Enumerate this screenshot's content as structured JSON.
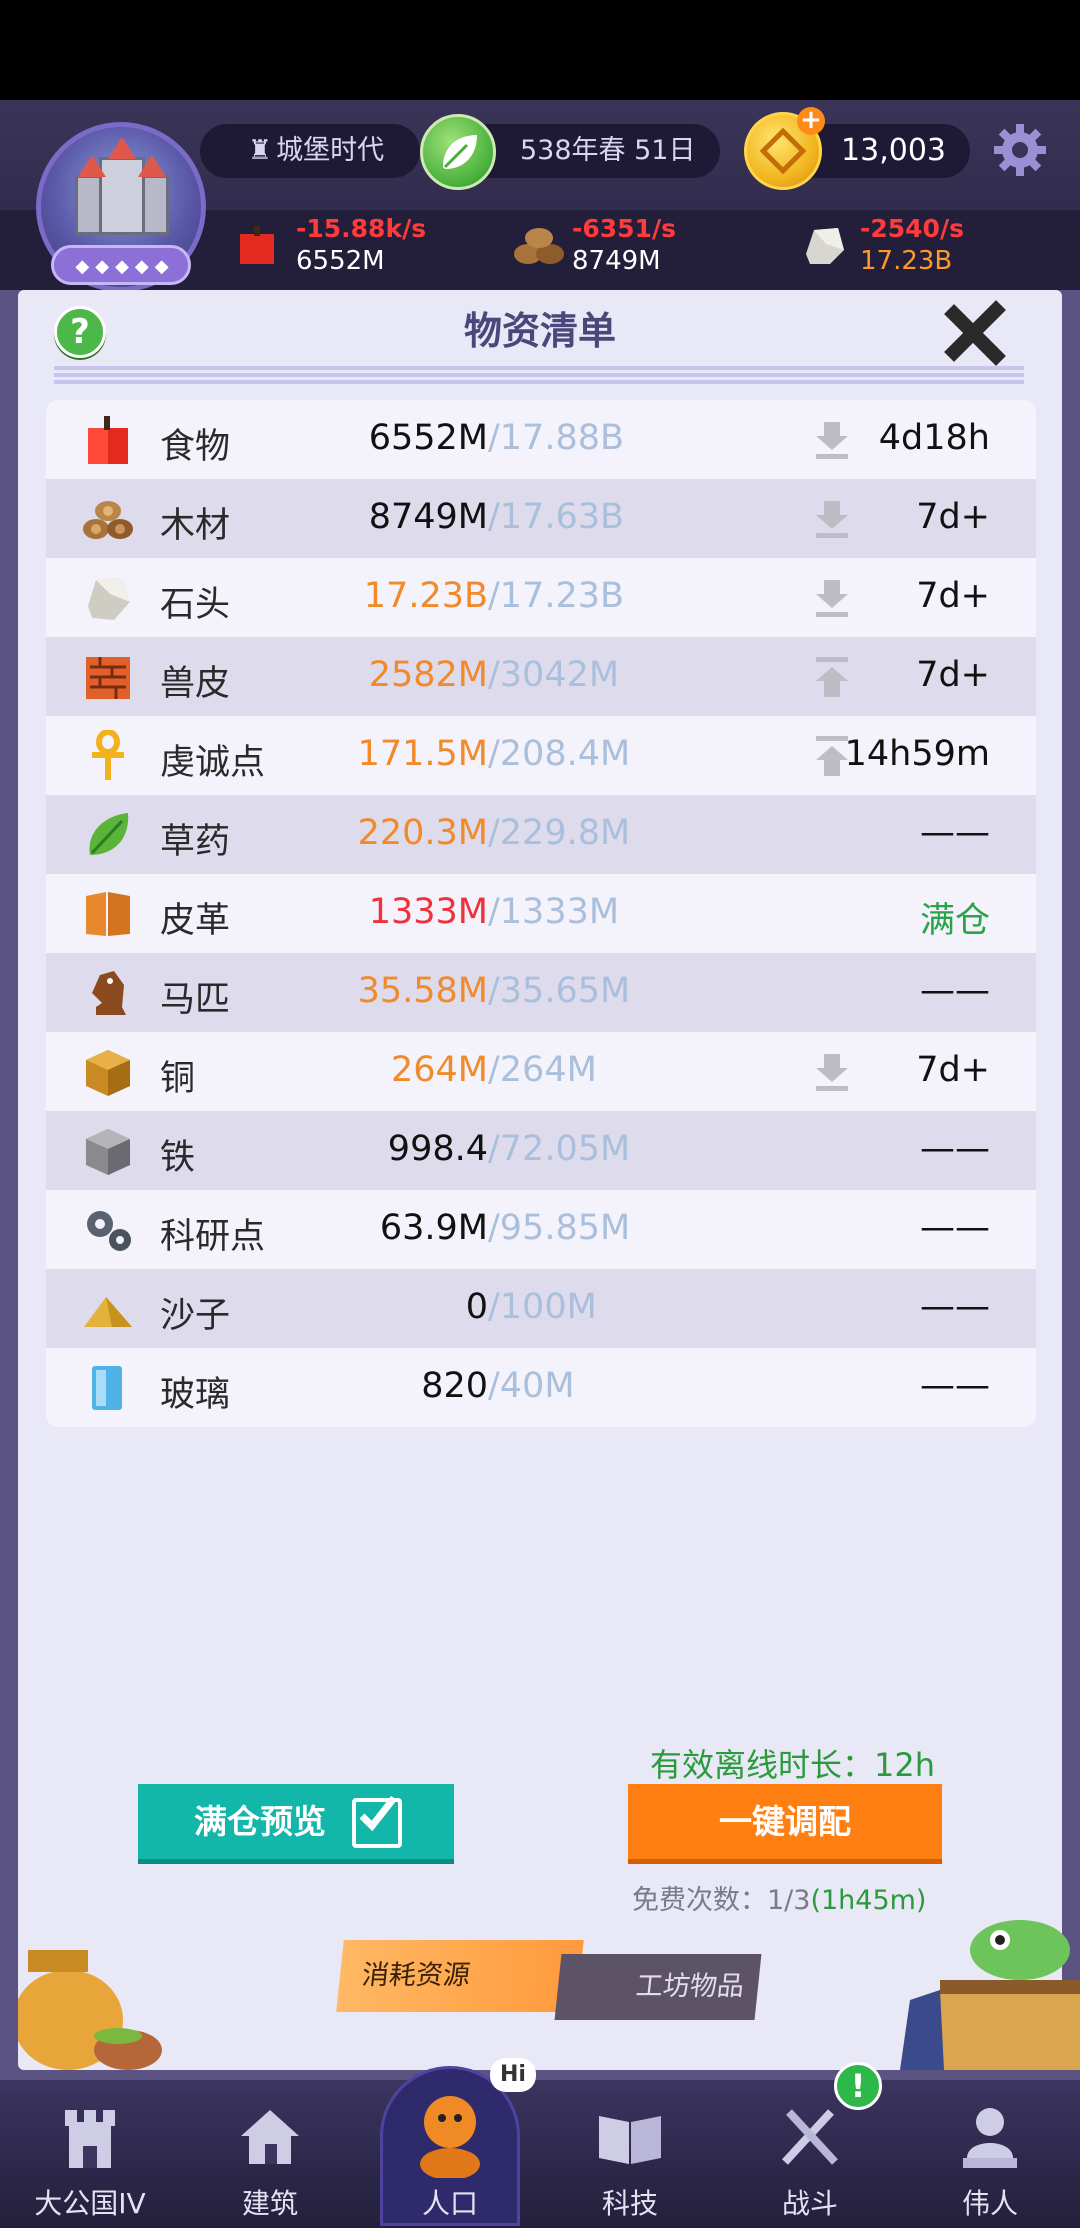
{
  "header": {
    "era": "城堡时代",
    "date": "538年春 51日",
    "gold": "13,003",
    "resources_top": [
      {
        "name": "food",
        "rate": "-15.88k/s",
        "amount": "6552M",
        "amount_color": "#ffffff"
      },
      {
        "name": "wood",
        "rate": "-6351/s",
        "amount": "8749M",
        "amount_color": "#ffffff"
      },
      {
        "name": "stone",
        "rate": "-2540/s",
        "amount": "17.23B",
        "amount_color": "#ff9a2a"
      }
    ]
  },
  "panel": {
    "title": "物资清单",
    "help": "?",
    "items": [
      {
        "icon": "apple-icon",
        "name": "食物",
        "amount": "6552M",
        "amount_color": "black",
        "cap": "/17.88B",
        "trend": "down",
        "time": "4d18h"
      },
      {
        "icon": "wood-logs-icon",
        "name": "木材",
        "amount": "8749M",
        "amount_color": "black",
        "cap": "/17.63B",
        "trend": "down",
        "time": "7d+"
      },
      {
        "icon": "stone-icon",
        "name": "石头",
        "amount": "17.23B",
        "amount_color": "orange",
        "cap": "/17.23B",
        "trend": "down",
        "time": "7d+"
      },
      {
        "icon": "hide-icon",
        "name": "兽皮",
        "amount": "2582M",
        "amount_color": "orange",
        "cap": "/3042M",
        "trend": "up",
        "time": "7d+"
      },
      {
        "icon": "ankh-icon",
        "name": "虔诚点",
        "amount": "171.5M",
        "amount_color": "orange",
        "cap": "/208.4M",
        "trend": "up",
        "time": "14h59m"
      },
      {
        "icon": "herb-leaf-icon",
        "name": "草药",
        "amount": "220.3M",
        "amount_color": "orange",
        "cap": "/229.8M",
        "trend": "none",
        "time": "——"
      },
      {
        "icon": "leather-icon",
        "name": "皮革",
        "amount": "1333M",
        "amount_color": "red",
        "cap": "/1333M",
        "trend": "none",
        "time": "满仓"
      },
      {
        "icon": "horse-knight-icon",
        "name": "马匹",
        "amount": "35.58M",
        "amount_color": "orange",
        "cap": "/35.65M",
        "trend": "none",
        "time": "——"
      },
      {
        "icon": "copper-cube-icon",
        "name": "铜",
        "amount": "264M",
        "amount_color": "orange",
        "cap": "/264M",
        "trend": "down",
        "time": "7d+"
      },
      {
        "icon": "iron-cube-icon",
        "name": "铁",
        "amount": "998.4",
        "amount_color": "black",
        "cap": "/72.05M",
        "trend": "none",
        "time": "——"
      },
      {
        "icon": "gears-icon",
        "name": "科研点",
        "amount": "63.9M",
        "amount_color": "black",
        "cap": "/95.85M",
        "trend": "none",
        "time": "——"
      },
      {
        "icon": "sand-pile-icon",
        "name": "沙子",
        "amount": "0",
        "amount_color": "black",
        "cap": "/100M",
        "trend": "none",
        "time": "——"
      },
      {
        "icon": "glass-pane-icon",
        "name": "玻璃",
        "amount": "820",
        "amount_color": "black",
        "cap": "/40M",
        "trend": "none",
        "time": "——"
      }
    ],
    "offline_label": "有效离线时长：12h",
    "preview_button": "满仓预览",
    "assign_button": "一键调配",
    "free_times_label": "免费次数：1/3",
    "free_times_timer": "(1h45m)",
    "tabs": [
      "消耗资源",
      "工坊物品"
    ]
  },
  "nav": {
    "items": [
      "大公国IV",
      "建筑",
      "人口",
      "科技",
      "战斗",
      "伟人"
    ],
    "hi_badge": "Hi",
    "alert_badge": "!"
  }
}
